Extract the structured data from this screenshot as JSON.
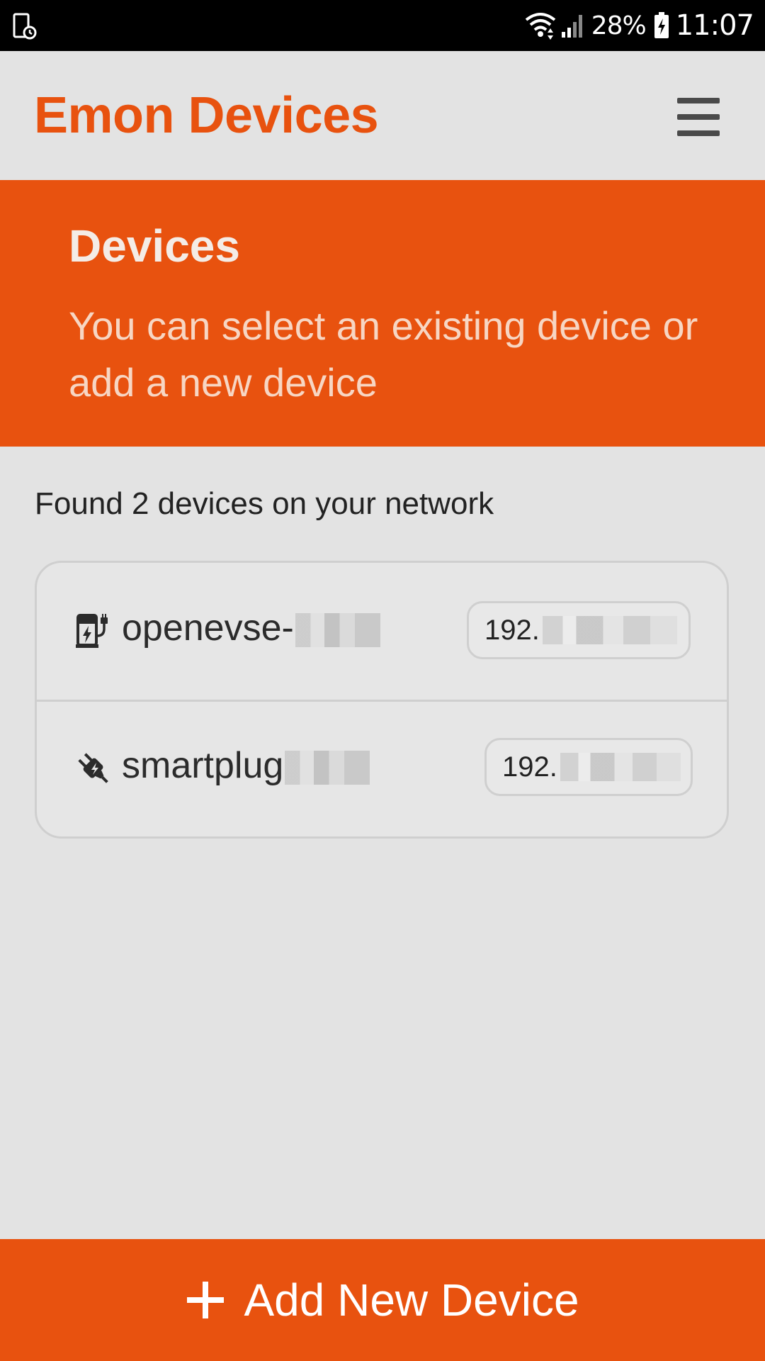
{
  "status_bar": {
    "battery": "28%",
    "time": "11:07",
    "icons": [
      "screen-time-icon",
      "wifi-icon",
      "signal-icon",
      "battery-charging-icon"
    ]
  },
  "header": {
    "title": "Emon Devices",
    "menu_icon": "hamburger-menu-icon"
  },
  "hero": {
    "title": "Devices",
    "subtitle": "You can select an existing device or add a new device"
  },
  "found_text": "Found 2 devices on your network",
  "devices": [
    {
      "icon": "ev-charger-icon",
      "name": "openevse-",
      "ip": "192."
    },
    {
      "icon": "plug-icon",
      "name": "smartplug",
      "ip": "192."
    }
  ],
  "add_button": {
    "icon": "plus-icon",
    "label": "Add New Device"
  },
  "colors": {
    "accent": "#e8520f",
    "background": "#e3e3e3",
    "text": "#2b2b2b"
  }
}
